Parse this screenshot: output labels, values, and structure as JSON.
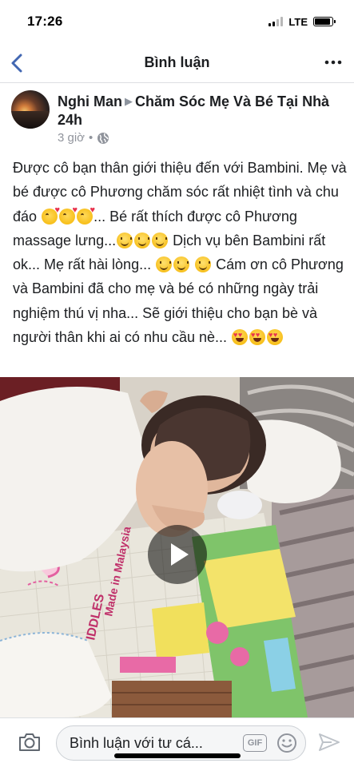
{
  "status_bar": {
    "time": "17:26",
    "network": "LTE",
    "signal_bars_active": 2,
    "signal_bars_total": 4,
    "battery_level": 0.9
  },
  "nav": {
    "back_icon": "chevron-left-icon",
    "title": "Bình luận",
    "more_icon": "more-horizontal-icon",
    "accent_color": "#4267b2"
  },
  "post": {
    "author": "Nghi Man",
    "separator_icon": "triangle-right-icon",
    "group": "Chăm Sóc Mẹ Và Bé Tại Nhà 24h",
    "time": "3 giờ",
    "dot": "•",
    "privacy_icon": "globe-icon",
    "text": {
      "part1": "Được cô bạn thân giới thiệu đến với Bambini. Mẹ và bé được cô Phương chăm sóc rất nhiệt tình và chu đáo",
      "part2": "... Bé rất thích được cô Phương massage lưng...",
      "part3": " Dịch vụ bên Bambini rất ok... Mẹ rất hài lòng...",
      "part4": " Cám ơn cô Phương và Bambini đã cho mẹ và bé có những ngày trải nghiệm thú vị nha... Sẽ giới thiệu cho bạn bè và người thân khi ai có nhu cầu nè..."
    },
    "emojis": {
      "kiss": "face-blowing-kiss-icon",
      "smile": "slightly-smiling-face-icon",
      "heart_eyes": "smiling-face-heart-eyes-icon"
    },
    "video": {
      "play_icon": "play-icon",
      "mat_print": "Made in Malaysia",
      "mat_brand": "IDDLES"
    }
  },
  "comment_bar": {
    "camera_icon": "camera-icon",
    "placeholder": "Bình luận với tư cá...",
    "gif_label": "GIF",
    "emoji_icon": "smiley-icon",
    "send_icon": "send-icon"
  }
}
